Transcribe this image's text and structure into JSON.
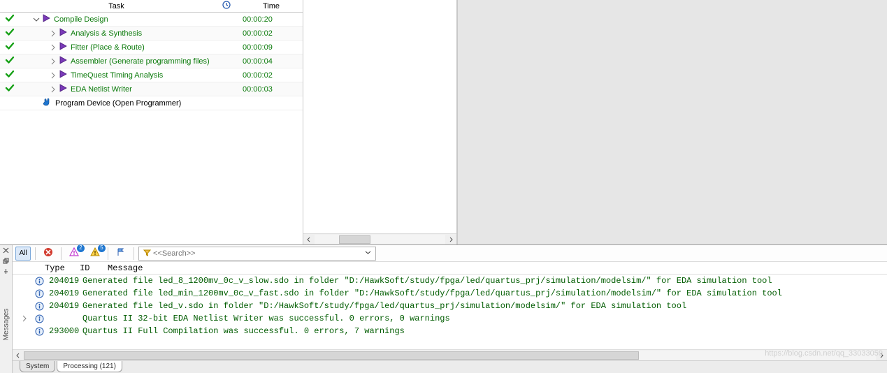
{
  "tasks": {
    "columns": {
      "task": "Task",
      "stat_icon": "clock-icon",
      "time": "Time"
    },
    "rows": [
      {
        "status": "ok",
        "indent": 0,
        "expander": "down",
        "icon": "play",
        "label": "Compile Design",
        "time": "00:00:20",
        "green": true
      },
      {
        "status": "ok",
        "indent": 1,
        "expander": "right",
        "icon": "play",
        "label": "Analysis & Synthesis",
        "time": "00:00:02",
        "green": true
      },
      {
        "status": "ok",
        "indent": 1,
        "expander": "right",
        "icon": "play",
        "label": "Fitter (Place & Route)",
        "time": "00:00:09",
        "green": true
      },
      {
        "status": "ok",
        "indent": 1,
        "expander": "right",
        "icon": "play",
        "label": "Assembler (Generate programming files)",
        "time": "00:00:04",
        "green": true
      },
      {
        "status": "ok",
        "indent": 1,
        "expander": "right",
        "icon": "play",
        "label": "TimeQuest Timing Analysis",
        "time": "00:00:02",
        "green": true
      },
      {
        "status": "ok",
        "indent": 1,
        "expander": "right",
        "icon": "play",
        "label": "EDA Netlist Writer",
        "time": "00:00:03",
        "green": true
      },
      {
        "status": "",
        "indent": 0,
        "expander": "none",
        "icon": "hand",
        "label": "Program Device (Open Programmer)",
        "time": "",
        "green": false
      }
    ]
  },
  "messages": {
    "sidebar_label": "Messages",
    "toolbar": {
      "all_label": "All",
      "warn_badge": "2",
      "info_badge": "5",
      "search_placeholder": "<<Search>>"
    },
    "headers": {
      "type": "Type",
      "id": "ID",
      "message": "Message"
    },
    "rows": [
      {
        "chev": "",
        "icon": "info",
        "id": "204019",
        "text": "Generated file led_8_1200mv_0c_v_slow.sdo in folder \"D:/HawkSoft/study/fpga/led/quartus_prj/simulation/modelsim/\" for EDA simulation tool"
      },
      {
        "chev": "",
        "icon": "info",
        "id": "204019",
        "text": "Generated file led_min_1200mv_0c_v_fast.sdo in folder \"D:/HawkSoft/study/fpga/led/quartus_prj/simulation/modelsim/\" for EDA simulation tool"
      },
      {
        "chev": "",
        "icon": "info",
        "id": "204019",
        "text": "Generated file led_v.sdo in folder \"D:/HawkSoft/study/fpga/led/quartus_prj/simulation/modelsim/\" for EDA simulation tool"
      },
      {
        "chev": ">",
        "icon": "info",
        "id": "",
        "text": "Quartus II 32-bit EDA Netlist Writer was successful. 0 errors, 0 warnings"
      },
      {
        "chev": "",
        "icon": "info",
        "id": "293000",
        "text": "Quartus II Full Compilation was successful. 0 errors, 7 warnings"
      }
    ],
    "tabs": [
      {
        "label": "System",
        "active": false
      },
      {
        "label": "Processing (121)",
        "active": true
      }
    ]
  },
  "watermark": "https://blog.csdn.net/qq_33033059"
}
